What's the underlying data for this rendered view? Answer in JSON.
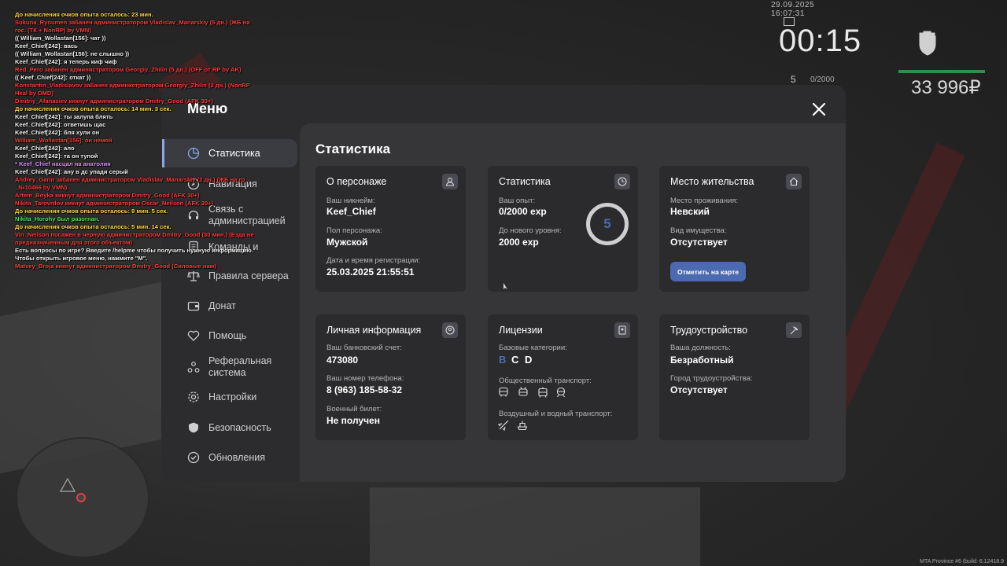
{
  "hud": {
    "datetime": "29.09.2025 16:07:31",
    "time": "00:15",
    "level": "5",
    "exp": "0/2000",
    "money": "33 996₽",
    "build": "MTA Province #6 (build: 6.12418.9"
  },
  "chat": [
    {
      "c": "y",
      "t": "До начисления очков опыта осталось: 23 мин."
    },
    {
      "c": "r",
      "t": "Sukuna_Ryoumen забанен администратором Vladislav_Manarskiy (5 дн.) (ЖБ на"
    },
    {
      "c": "r",
      "t": "гос. (ТК + NonRP) by VMN)"
    },
    {
      "c": "w",
      "t": "(( William_Wollastan[156]: чат ))"
    },
    {
      "c": "w",
      "t": "Keef_Chief[242]: вась"
    },
    {
      "c": "w",
      "t": "(( William_Wollastan[156]: не слышно ))"
    },
    {
      "c": "w",
      "t": "Keef_Chief[242]: я теперь киф чиф"
    },
    {
      "c": "r",
      "t": "Red_Pero забанен администратором Georgiy_Zhilin (5 дн.) (OFF от RP by AK)"
    },
    {
      "c": "w",
      "t": "(( Keef_Chief[242]: откат ))"
    },
    {
      "c": "r",
      "t": "Konstantin_Vladislavov забанен администратором Georgiy_Zhilin (2 дн.) (NonRP"
    },
    {
      "c": "r",
      "t": " Heal by DMD)"
    },
    {
      "c": "r",
      "t": "Dmitriy_Afanasiev кикнут администратором Dmitry_Good (AFK 30+)"
    },
    {
      "c": "y",
      "t": "До начисления очков опыта осталось: 14 мин. 3 сек."
    },
    {
      "c": "w",
      "t": "Keef_Chief[242]: ты залупа блять"
    },
    {
      "c": "w",
      "t": "Keef_Chief[242]: ответишь щас"
    },
    {
      "c": "w",
      "t": "Keef_Chief[242]: бля хули он"
    },
    {
      "c": "r",
      "t": "William_Wollastan[156]: он немой"
    },
    {
      "c": "w",
      "t": "Keef_Chief[242]: ало"
    },
    {
      "c": "w",
      "t": "Keef_Chief[242]: та он тупой"
    },
    {
      "c": "p",
      "t": " * Keef_Chief насцал на анатолия"
    },
    {
      "c": "w",
      "t": "Keef_Chief[242]: ану в дс упади серый"
    },
    {
      "c": "r",
      "t": "Andrey_Garin забанен администратором Vladislav_Manarskiy (2 дн.) (ЖБ на гр"
    },
    {
      "c": "r",
      "t": "_№10466 by VMN)"
    },
    {
      "c": "r",
      "t": "Artem_Boyka кикнут администратором Dmitry_Good (AFK 30+)"
    },
    {
      "c": "r",
      "t": "Nikita_Tarovrdov кикнут администратором Oscar_Neilson (AFK 30+)"
    },
    {
      "c": "y",
      "t": "До начисления очков опыта осталось: 9 мин. 5 сек."
    },
    {
      "c": "g",
      "t": "Nikita_Horohy был разогнан."
    },
    {
      "c": "y",
      "t": "До начисления очков опыта осталось: 5 мин. 14 сек."
    },
    {
      "c": "r",
      "t": "Vin_Neilson посажен в черную администратором Dmitry_Good (30 мин.) (Езда не"
    },
    {
      "c": "r",
      "t": "предназначенным для этого объектом)"
    },
    {
      "c": "w",
      "t": "Есть вопросы по игре? Введите /helpme чтобы получить нужную информацию."
    },
    {
      "c": "w",
      "t": "Чтобы открыть игровое меню, нажмите \"M\"."
    },
    {
      "c": "r",
      "t": "Matvey_Broja кикнут администратором Dmitry_Good (Силовые нам)"
    }
  ],
  "menu": {
    "title": "Меню",
    "sidebar": [
      {
        "label": "Статистика",
        "icon": "pie-chart-icon",
        "active": true
      },
      {
        "label": "Навигация",
        "icon": "compass-icon"
      },
      {
        "label": "Связь с администрацией",
        "icon": "headset-icon"
      },
      {
        "label": "Команды и",
        "icon": "document-icon"
      },
      {
        "label": "Правила сервера",
        "icon": "scales-icon"
      },
      {
        "label": "Донат",
        "icon": "wallet-icon"
      },
      {
        "label": "Помощь",
        "icon": "heart-hand-icon"
      },
      {
        "label": "Реферальная система",
        "icon": "referral-icon"
      },
      {
        "label": "Настройки",
        "icon": "gear-icon"
      },
      {
        "label": "Безопасность",
        "icon": "shield-icon"
      },
      {
        "label": "Обновления",
        "icon": "refresh-check-icon"
      }
    ],
    "content_title": "Статистика",
    "cards": {
      "character": {
        "title": "О персонаже",
        "nick_label": "Ваш никнейм:",
        "nick": "Keef_Chief",
        "gender_label": "Пол персонажа:",
        "gender": "Мужской",
        "reg_label": "Дата и время регистрации:",
        "reg": "25.03.2025 21:55:51"
      },
      "stats": {
        "title": "Статистика",
        "exp_label": "Ваш опыт:",
        "exp": "0/2000 exp",
        "next_label": "До нового уровня:",
        "next": "2000 exp",
        "level": "5"
      },
      "residence": {
        "title": "Место жительства",
        "place_label": "Место проживания:",
        "place": "Невский",
        "property_label": "Вид имущества:",
        "property": "Отсутствует",
        "button": "Отметить на карте"
      },
      "personal": {
        "title": "Личная информация",
        "bank_label": "Ваш банковский счет:",
        "bank": "473080",
        "phone_label": "Ваш номер телефона:",
        "phone": "8 (963) 185-58-32",
        "military_label": "Военный билет:",
        "military": "Не получен"
      },
      "licenses": {
        "title": "Лицензии",
        "base_label": "Базовые категории:",
        "cat_b": "B",
        "cat_c": "C",
        "cat_d": "D",
        "public_label": "Общественный транспорт:",
        "air_label": "Воздушный и водный транспорт:"
      },
      "employment": {
        "title": "Трудоустройство",
        "position_label": "Ваша должность:",
        "position": "Безработный",
        "city_label": "Город трудоустройства:",
        "city": "Отсутствует"
      }
    }
  },
  "colors": {
    "accent": "#4b6ab0",
    "active_border": "#8aa8e6",
    "category_active": "#4b6ab0"
  }
}
